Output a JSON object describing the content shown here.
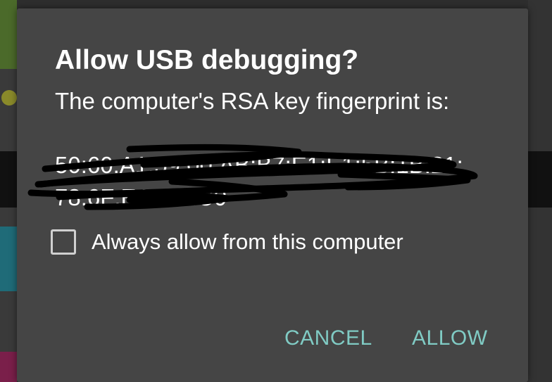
{
  "dialog": {
    "title": "Allow USB debugging?",
    "message": "The computer's RSA key fingerprint is:",
    "fingerprint": "50:60:A1:59:00:AB:B7:E1:E1:5B:1B:21:\n78:6F:EA:ED:C0",
    "checkbox": {
      "label": "Always allow from this computer",
      "checked": false
    },
    "buttons": {
      "cancel": "CANCEL",
      "allow": "ALLOW"
    }
  },
  "colors": {
    "dialog_bg": "#454545",
    "accent": "#80cbc4",
    "text": "#ffffff"
  }
}
